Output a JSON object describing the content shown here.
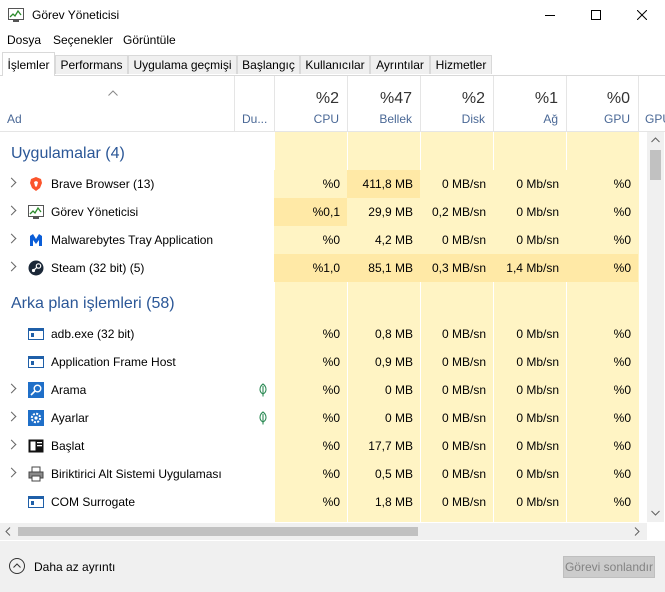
{
  "window": {
    "title": "Görev Yöneticisi"
  },
  "menu": [
    "Dosya",
    "Seçenekler",
    "Görüntüle"
  ],
  "tabs": [
    "İşlemler",
    "Performans",
    "Uygulama geçmişi",
    "Başlangıç",
    "Kullanıcılar",
    "Ayrıntılar",
    "Hizmetler"
  ],
  "columns": {
    "name": "Ad",
    "status": "Du...",
    "cpu": {
      "pct": "%2",
      "label": "CPU"
    },
    "memory": {
      "pct": "%47",
      "label": "Bellek"
    },
    "disk": {
      "pct": "%2",
      "label": "Disk"
    },
    "network": {
      "pct": "%1",
      "label": "Ağ"
    },
    "gpu": {
      "pct": "%0",
      "label": "GPU"
    },
    "gpu_engine": "GPU"
  },
  "groups": {
    "apps": "Uygulamalar (4)",
    "background": "Arka plan işlemleri (58)"
  },
  "apps": [
    {
      "name": "Brave Browser (13)",
      "cpu": "%0",
      "memory": "411,8 MB",
      "disk": "0 MB/sn",
      "network": "0 Mb/sn",
      "gpu": "%0"
    },
    {
      "name": "Görev Yöneticisi",
      "cpu": "%0,1",
      "memory": "29,9 MB",
      "disk": "0,2 MB/sn",
      "network": "0 Mb/sn",
      "gpu": "%0"
    },
    {
      "name": "Malwarebytes Tray Application",
      "cpu": "%0",
      "memory": "4,2 MB",
      "disk": "0 MB/sn",
      "network": "0 Mb/sn",
      "gpu": "%0"
    },
    {
      "name": "Steam (32 bit) (5)",
      "cpu": "%1,0",
      "memory": "85,1 MB",
      "disk": "0,3 MB/sn",
      "network": "1,4 Mb/sn",
      "gpu": "%0"
    }
  ],
  "background": [
    {
      "name": "adb.exe (32 bit)",
      "cpu": "%0",
      "memory": "0,8 MB",
      "disk": "0 MB/sn",
      "network": "0 Mb/sn",
      "gpu": "%0"
    },
    {
      "name": "Application Frame Host",
      "cpu": "%0",
      "memory": "0,9 MB",
      "disk": "0 MB/sn",
      "network": "0 Mb/sn",
      "gpu": "%0"
    },
    {
      "name": "Arama",
      "cpu": "%0",
      "memory": "0 MB",
      "disk": "0 MB/sn",
      "network": "0 Mb/sn",
      "gpu": "%0"
    },
    {
      "name": "Ayarlar",
      "cpu": "%0",
      "memory": "0 MB",
      "disk": "0 MB/sn",
      "network": "0 Mb/sn",
      "gpu": "%0"
    },
    {
      "name": "Başlat",
      "cpu": "%0",
      "memory": "17,7 MB",
      "disk": "0 MB/sn",
      "network": "0 Mb/sn",
      "gpu": "%0"
    },
    {
      "name": "Biriktirici Alt Sistemi Uygulaması",
      "cpu": "%0",
      "memory": "0,5 MB",
      "disk": "0 MB/sn",
      "network": "0 Mb/sn",
      "gpu": "%0"
    },
    {
      "name": "COM Surrogate",
      "cpu": "%0",
      "memory": "1,8 MB",
      "disk": "0 MB/sn",
      "network": "0 Mb/sn",
      "gpu": "%0"
    }
  ],
  "footer": {
    "less_details": "Daha az ayrıntı",
    "end_task": "Görevi sonlandır"
  },
  "colors": {
    "heat_light": "#fff4c4",
    "heat_medium": "#ffe9a6",
    "group_title": "#2b5797"
  }
}
